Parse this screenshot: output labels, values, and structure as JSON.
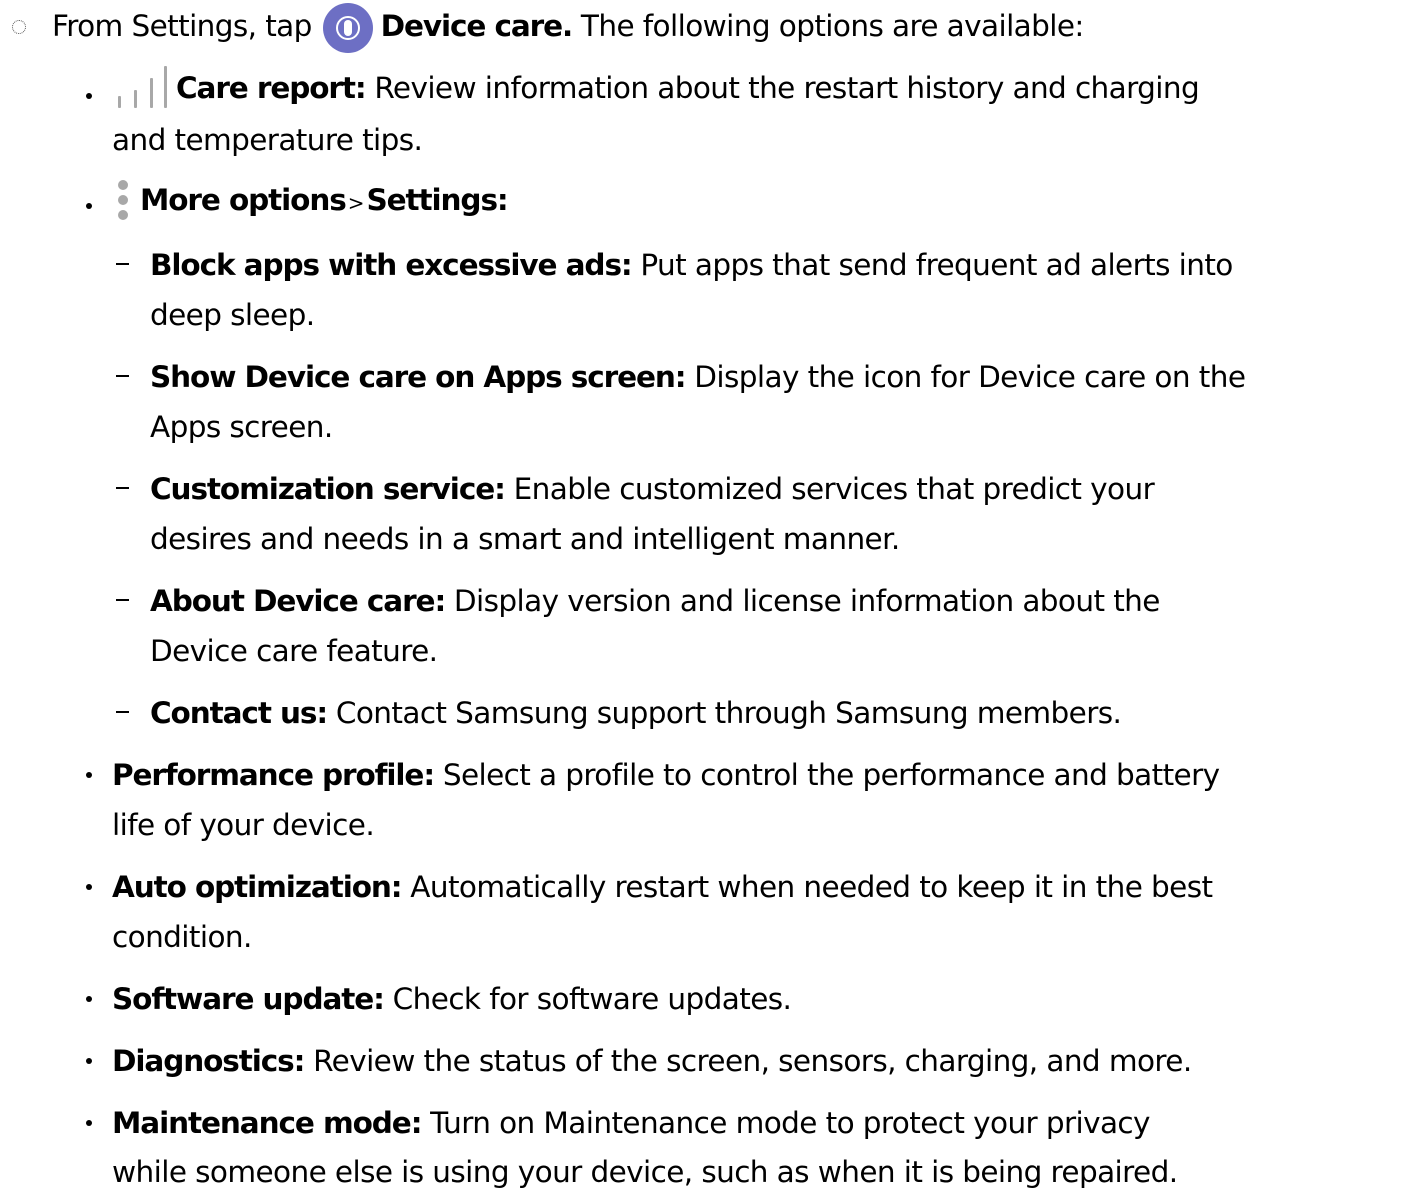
{
  "intro": {
    "prefix": "From Settings, tap",
    "icon": "device-care-icon",
    "bold": "Device care.",
    "rest": "The following options are available:"
  },
  "items": {
    "care_report": {
      "icon": "care-report-bars-icon",
      "title": "Care report:",
      "desc_line1": "Review information about the restart history and charging",
      "desc_line2": "and temperature tips."
    },
    "more_options": {
      "icon": "more-options-kebab-icon",
      "title": "More options",
      "separator": ">",
      "title2": "Settings:",
      "subitems": [
        {
          "title": "Block apps with excessive ads:",
          "line1": "Put apps that send frequent ad alerts into",
          "line2": "deep sleep."
        },
        {
          "title": "Show Device care on Apps screen:",
          "line1": "Display the icon for Device care on the",
          "line2": "Apps screen."
        },
        {
          "title": "Customization service:",
          "line1": "Enable customized services that predict your",
          "line2": "desires and needs in a smart and intelligent manner."
        },
        {
          "title": "About Device care:",
          "line1": "Display version and license information about the",
          "line2": "Device care feature."
        },
        {
          "title": "Contact us:",
          "line1": "Contact Samsung support through Samsung members."
        }
      ]
    },
    "performance_profile": {
      "title": "Performance profile:",
      "line1": "Select a profile to control the performance and battery",
      "line2": "life of your device."
    },
    "auto_optimization": {
      "title": "Auto optimization:",
      "line1": "Automatically restart when needed to keep it in the best",
      "line2": "condition."
    },
    "software_update": {
      "title": "Software update:",
      "line1": "Check for software updates."
    },
    "diagnostics": {
      "title": "Diagnostics:",
      "line1": "Review the status of the screen, sensors, charging, and more."
    },
    "maintenance_mode": {
      "title": "Maintenance mode:",
      "line1": "Turn on Maintenance mode to protect your privacy",
      "line2": "while someone else is using your device, such as when it is being repaired."
    }
  }
}
